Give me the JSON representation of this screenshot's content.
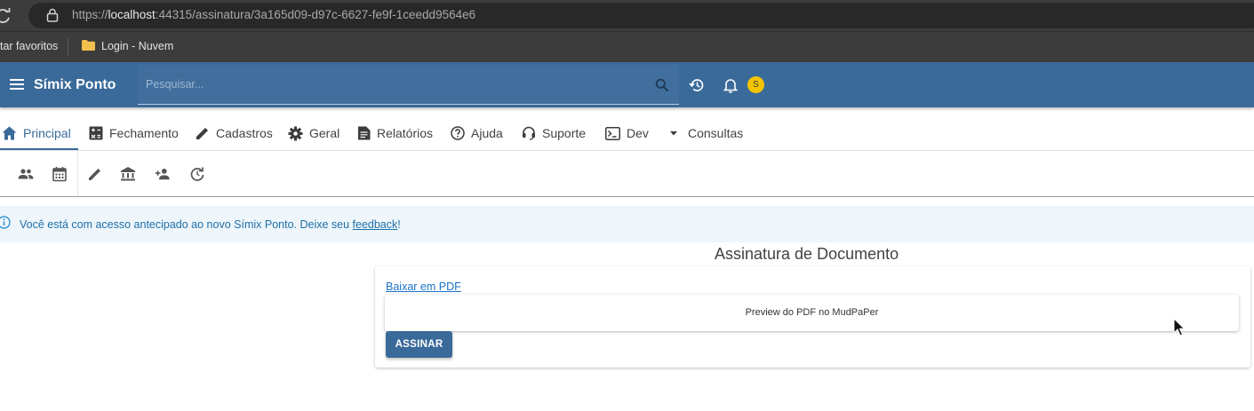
{
  "browser": {
    "url_prefix": "https://",
    "url_host": "localhost",
    "url_rest": ":44315/assinatura/3a165d09-d97c-6627-fe9f-1ceedd9564e6",
    "bookmarks": [
      {
        "label": "tar favoritos"
      },
      {
        "label": "Login - Nuvem"
      }
    ]
  },
  "appbar": {
    "brand": "Símix Ponto",
    "search_placeholder": "Pesquisar...",
    "avatar_initial": "S",
    "colors": {
      "primary": "#3a6a9a",
      "avatar": "#f5c400"
    }
  },
  "tabs": [
    {
      "label": "Principal",
      "icon": "home-icon",
      "active": true
    },
    {
      "label": "Fechamento",
      "icon": "calculator-icon"
    },
    {
      "label": "Cadastros",
      "icon": "pencil-icon"
    },
    {
      "label": "Geral",
      "icon": "gear-icon"
    },
    {
      "label": "Relatórios",
      "icon": "report-icon"
    },
    {
      "label": "Ajuda",
      "icon": "help-icon"
    },
    {
      "label": "Suporte",
      "icon": "headset-icon"
    },
    {
      "label": "Dev",
      "icon": "terminal-icon"
    },
    {
      "label": "Consultas",
      "icon": "caret-down-icon"
    }
  ],
  "toolbar_icons": [
    "people-icon",
    "calendar-icon",
    "edit-icon",
    "bank-icon",
    "person-add-icon",
    "refresh-icon"
  ],
  "alert": {
    "text_before": "Você está com acesso antecipado ao novo Símix Ponto. Deixe seu ",
    "link": "feedback",
    "text_after": "!"
  },
  "main": {
    "title": "Assinatura de Documento",
    "download_link": "Baixar em PDF",
    "preview_text": "Preview do PDF no MudPaPer",
    "sign_button": "ASSINAR"
  }
}
